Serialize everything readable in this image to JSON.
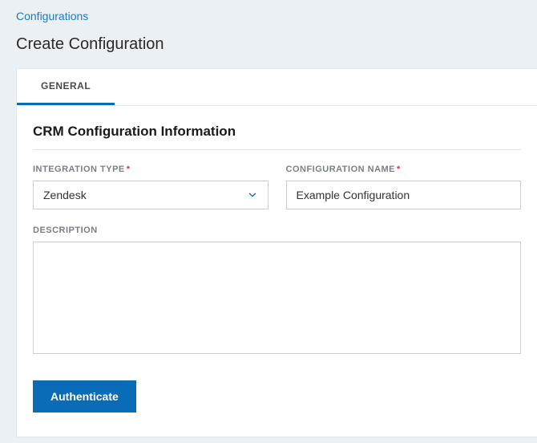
{
  "breadcrumb": {
    "label": "Configurations"
  },
  "page_title": "Create Configuration",
  "tabs": [
    {
      "label": "GENERAL",
      "active": true
    }
  ],
  "section": {
    "title": "CRM Configuration Information"
  },
  "form": {
    "integration_type": {
      "label": "INTEGRATION TYPE",
      "required_mark": "*",
      "value": "Zendesk"
    },
    "configuration_name": {
      "label": "CONFIGURATION NAME",
      "required_mark": "*",
      "value": "Example Configuration"
    },
    "description": {
      "label": "DESCRIPTION",
      "value": ""
    }
  },
  "actions": {
    "authenticate_label": "Authenticate"
  }
}
